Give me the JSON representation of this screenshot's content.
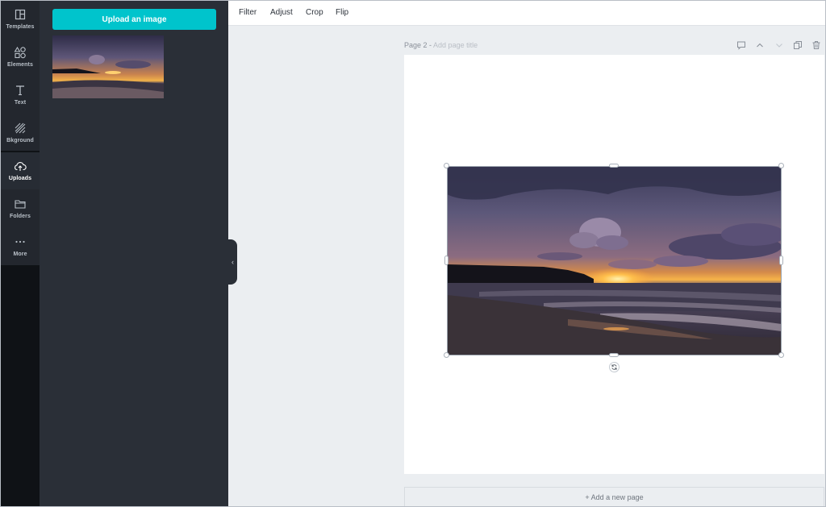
{
  "sidebar": {
    "items": [
      {
        "label": "Templates",
        "icon": "templates-icon"
      },
      {
        "label": "Elements",
        "icon": "elements-icon"
      },
      {
        "label": "Text",
        "icon": "text-icon"
      },
      {
        "label": "Bkground",
        "icon": "background-icon"
      },
      {
        "label": "Uploads",
        "icon": "upload-cloud-icon",
        "active": true
      },
      {
        "label": "Folders",
        "icon": "folder-icon"
      },
      {
        "label": "More",
        "icon": "more-dots-icon"
      }
    ]
  },
  "uploads_panel": {
    "upload_button_label": "Upload an image"
  },
  "toolbar": {
    "filter": "Filter",
    "adjust": "Adjust",
    "crop": "Crop",
    "flip": "Flip"
  },
  "page": {
    "number_label": "Page 2 -",
    "title_placeholder": "Add page title",
    "add_page_label": "+ Add a new page"
  },
  "colors": {
    "accent": "#00c4cc",
    "rail_bg": "#0f1216",
    "panel_bg": "#2a2f37",
    "workspace_bg": "#ebeef1"
  }
}
